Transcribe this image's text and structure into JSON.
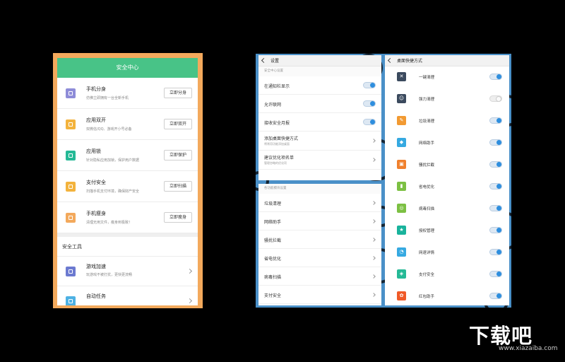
{
  "security_center": {
    "title": "安全中心",
    "features": [
      {
        "title": "手机分身",
        "desc": "仿佛立即拥有一台全新手机",
        "button": "立即分身",
        "color": "#8e8cd8",
        "icon": "clone-icon"
      },
      {
        "title": "应用双开",
        "desc": "双微信/QQ、游戏开小号必备",
        "button": "立即双开",
        "color": "#f3b33d",
        "icon": "dual-app-icon"
      },
      {
        "title": "应用锁",
        "desc": "针对隐私应用加锁，保护用户数据",
        "button": "立即保护",
        "color": "#25b996",
        "icon": "app-lock-icon"
      },
      {
        "title": "支付安全",
        "desc": "扫描手机支付环境，确保财产安全",
        "button": "立即扫描",
        "color": "#f3b33d",
        "icon": "payment-shield-icon"
      },
      {
        "title": "手机瘦身",
        "desc": "清理无用文件，瘦身到极致！",
        "button": "立即瘦身",
        "color": "#f3a95c",
        "icon": "slim-bag-icon"
      }
    ],
    "tools_title": "安全工具",
    "tools": [
      {
        "title": "游戏加速",
        "desc": "玩游戏不被打扰，更快更流畅",
        "color": "#6c7ad0",
        "icon": "gamepad-icon"
      },
      {
        "title": "自动任务",
        "desc": "",
        "color": "#4db1e3",
        "icon": "auto-task-icon"
      }
    ]
  },
  "settings": {
    "title": "设置",
    "section1_label": "安全中心设置",
    "toggles": [
      {
        "label": "在通知栏显示",
        "on": true
      },
      {
        "label": "允许联网",
        "on": true
      },
      {
        "label": "接收安全月报",
        "on": true
      }
    ],
    "links": [
      {
        "label": "添加桌面快捷方式",
        "sub": "将常用功能添加桌面"
      },
      {
        "label": "建议优化项名单",
        "sub": "管理忽略的优化项"
      }
    ],
    "section2_label": "各功能模块设置",
    "modules": [
      "垃圾清理",
      "网络助手",
      "骚扰拦截",
      "省电优化",
      "病毒扫描",
      "支付安全"
    ]
  },
  "shortcuts": {
    "title": "桌面快捷方式",
    "items": [
      {
        "label": "一键清理",
        "color": "#3b4a5e",
        "glyph": "✕",
        "icon": "one-key-clean-icon",
        "on": true
      },
      {
        "label": "强力清理",
        "color": "#3b4a5e",
        "glyph": "☺",
        "icon": "power-clean-icon",
        "on": false
      },
      {
        "label": "垃圾清理",
        "color": "#f29a32",
        "glyph": "✎",
        "icon": "brush-icon",
        "on": true
      },
      {
        "label": "网络助手",
        "color": "#36a9e1",
        "glyph": "◆",
        "icon": "network-drop-icon",
        "on": true
      },
      {
        "label": "骚扰拦截",
        "color": "#f0802d",
        "glyph": "▣",
        "icon": "block-icon",
        "on": true
      },
      {
        "label": "省电优化",
        "color": "#7cc043",
        "glyph": "▮",
        "icon": "battery-icon",
        "on": true
      },
      {
        "label": "病毒扫描",
        "color": "#7cc043",
        "glyph": "◎",
        "icon": "virus-scan-icon",
        "on": true
      },
      {
        "label": "授权管理",
        "color": "#19b39c",
        "glyph": "★",
        "icon": "authorization-star-icon",
        "on": true
      },
      {
        "label": "网速详情",
        "color": "#36a9e1",
        "glyph": "◔",
        "icon": "speed-gauge-icon",
        "on": true
      },
      {
        "label": "支付安全",
        "color": "#25b996",
        "glyph": "◈",
        "icon": "payment-shield-icon",
        "on": true
      },
      {
        "label": "红包助手",
        "color": "#f05a28",
        "glyph": "✿",
        "icon": "red-packet-icon",
        "on": true
      }
    ]
  },
  "watermark": {
    "text": "下载吧",
    "url": "www.xiazaiba.com"
  }
}
